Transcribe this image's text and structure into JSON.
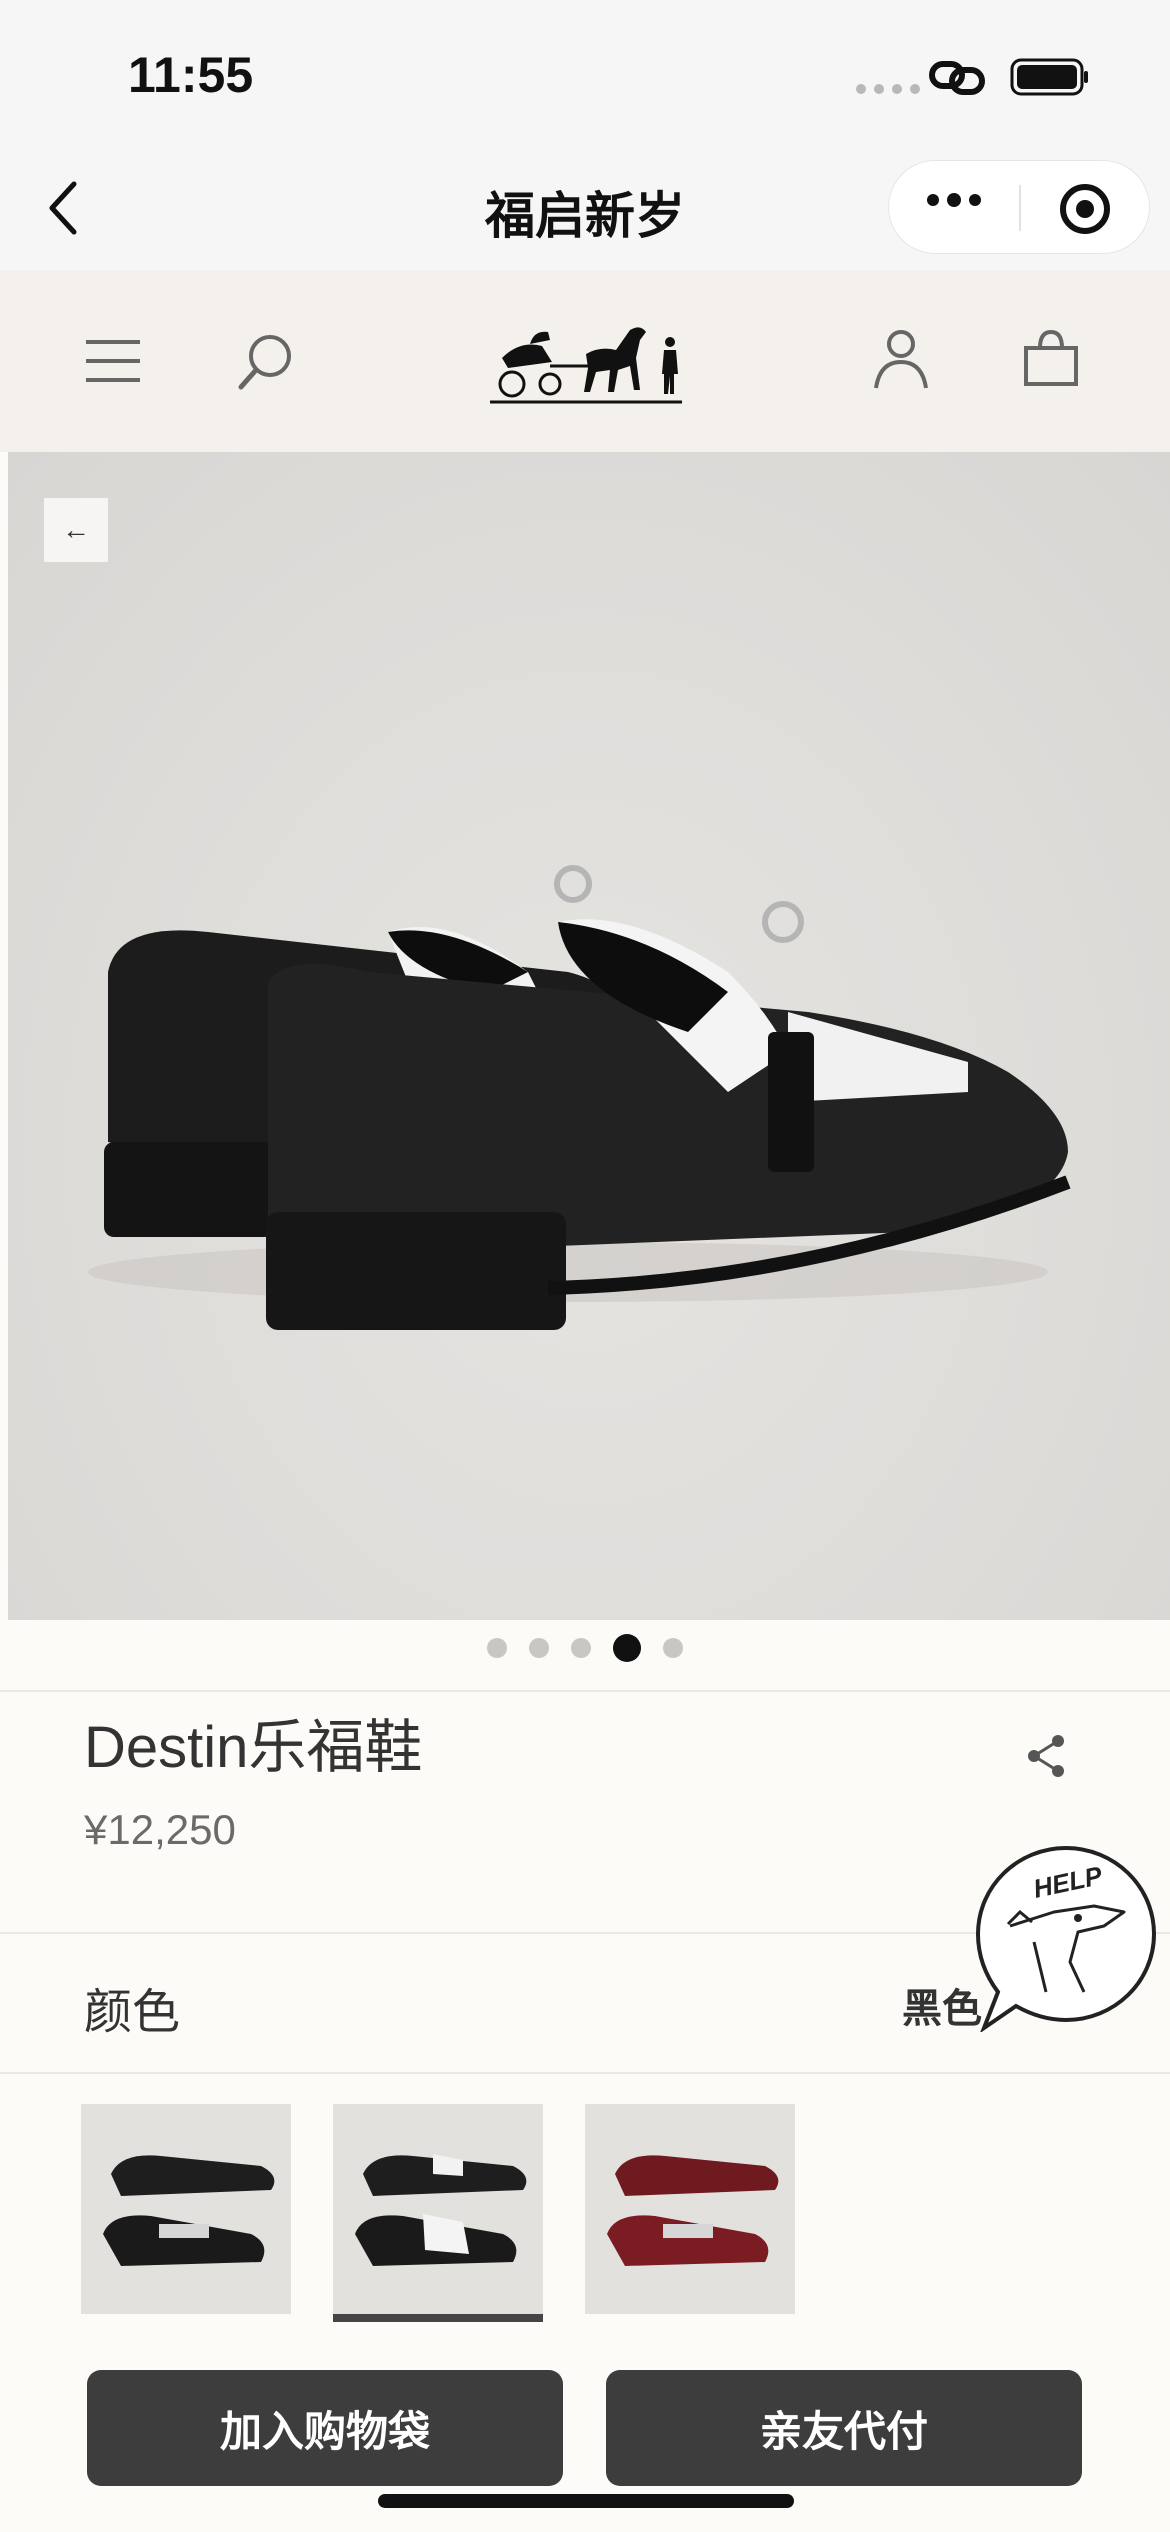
{
  "status_bar": {
    "time": "11:55"
  },
  "mini_program": {
    "title": "福启新岁"
  },
  "product": {
    "name": "Destin乐福鞋",
    "price": "¥12,250",
    "color_label": "颜色",
    "color_value": "黑色",
    "image_count": 5,
    "active_image_index": 3,
    "swatches": [
      "black",
      "black-white",
      "burgundy"
    ],
    "selected_swatch_index": 1
  },
  "help": {
    "label": "HELP"
  },
  "actions": {
    "add_to_bag": "加入购物袋",
    "pay_for_me": "亲友代付"
  },
  "colors": {
    "header_bg": "#f4f1ec",
    "page_bg": "#fcfbf8",
    "button_bg": "#3d3d3d"
  }
}
